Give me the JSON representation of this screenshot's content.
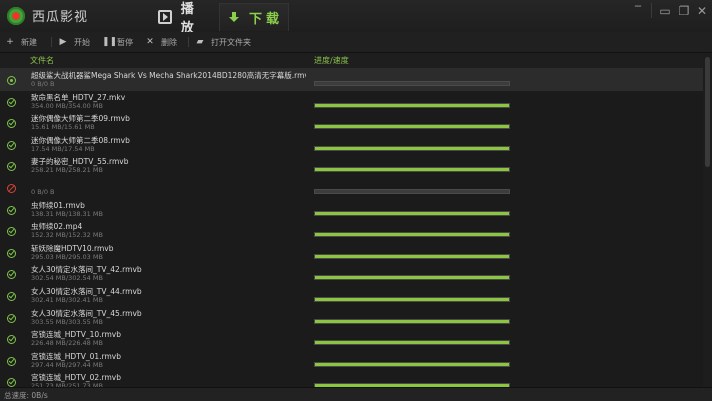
{
  "app": {
    "title": "西瓜影视"
  },
  "nav": {
    "tabs": [
      {
        "label": "播放",
        "icon": "play-icon"
      },
      {
        "label": "下载",
        "icon": "download-icon",
        "active": true
      }
    ]
  },
  "window_controls": [
    "minimize-icon",
    "window-icon",
    "restore-icon",
    "close-icon"
  ],
  "toolbar": {
    "new_label": "新建",
    "start_label": "开始",
    "pause_label": "暂停",
    "delete_label": "删除",
    "open_folder_label": "打开文件夹"
  },
  "columns": {
    "name": "文件名",
    "progress": "进度/速度"
  },
  "accent_color": "#8cc63f",
  "rows": [
    {
      "name": "超级鲨大战机器鲨Mega Shark Vs Mecha Shark2014BD1280高清无字幕版.rmvb",
      "size": "0 B/0 B",
      "status": "pending",
      "progress": 0,
      "selected": true
    },
    {
      "name": "致命黑名单_HDTV_27.mkv",
      "size": "354.00 MB/354.00 MB",
      "status": "done",
      "progress": 1
    },
    {
      "name": "迷你偶像大师第二季09.rmvb",
      "size": "15.61 MB/15.61 MB",
      "status": "done",
      "progress": 1
    },
    {
      "name": "迷你偶像大师第二季08.rmvb",
      "size": "17.54 MB/17.54 MB",
      "status": "done",
      "progress": 1
    },
    {
      "name": "妻子的秘密_HDTV_55.rmvb",
      "size": "258.21 MB/258.21 MB",
      "status": "done",
      "progress": 1
    },
    {
      "name": "",
      "size": "0 B/0 B",
      "status": "error",
      "progress": 0
    },
    {
      "name": "虫师续01.rmvb",
      "size": "138.31 MB/138.31 MB",
      "status": "done",
      "progress": 1
    },
    {
      "name": "虫师续02.mp4",
      "size": "152.32 MB/152.32 MB",
      "status": "done",
      "progress": 1
    },
    {
      "name": "斩妖除魔HDTV10.rmvb",
      "size": "295.03 MB/295.03 MB",
      "status": "done",
      "progress": 1
    },
    {
      "name": "女人30情定水落间_TV_42.rmvb",
      "size": "302.54 MB/302.54 MB",
      "status": "done",
      "progress": 1
    },
    {
      "name": "女人30情定水落间_TV_44.rmvb",
      "size": "302.41 MB/302.41 MB",
      "status": "done",
      "progress": 1
    },
    {
      "name": "女人30情定水落间_TV_45.rmvb",
      "size": "303.55 MB/303.55 MB",
      "status": "done",
      "progress": 1
    },
    {
      "name": "宫锁连城_HDTV_10.rmvb",
      "size": "226.48 MB/226.48 MB",
      "status": "done",
      "progress": 1
    },
    {
      "name": "宫锁连城_HDTV_01.rmvb",
      "size": "297.44 MB/297.44 MB",
      "status": "done",
      "progress": 1
    },
    {
      "name": "宫锁连城_HDTV_02.rmvb",
      "size": "251.73 MB/251.73 MB",
      "status": "done",
      "progress": 1
    }
  ],
  "statusbar": {
    "text": "总速度: 0B/s"
  }
}
